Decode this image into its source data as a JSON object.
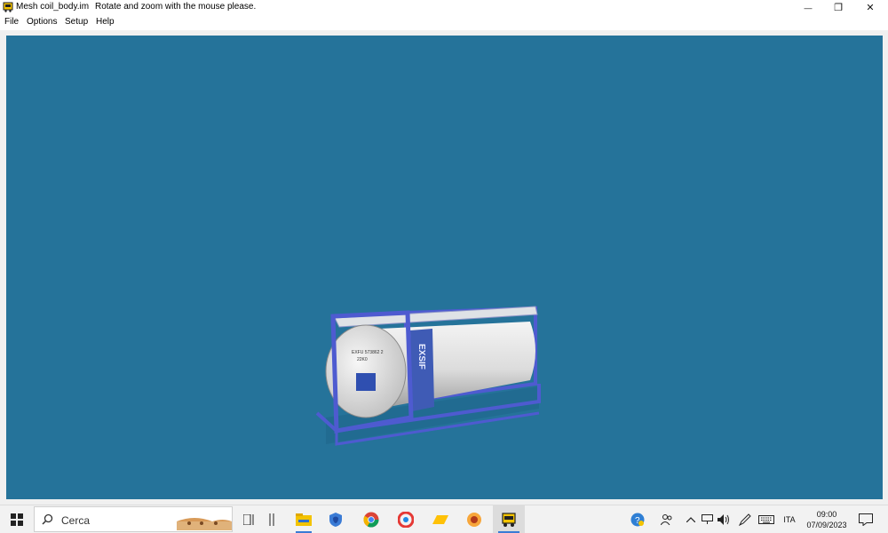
{
  "window": {
    "title": "Mesh coil_body.im",
    "hint": "Rotate and zoom with the mouse please.",
    "controls": {
      "minimize": "—",
      "restore": "❐",
      "close": "✕"
    }
  },
  "menu": {
    "items": [
      {
        "id": "file",
        "label": "File"
      },
      {
        "id": "options",
        "label": "Options"
      },
      {
        "id": "setup",
        "label": "Setup"
      },
      {
        "id": "help",
        "label": "Help"
      }
    ]
  },
  "viewport": {
    "background": "#25739a",
    "model": {
      "container_text": {
        "brand": "EXSIF",
        "code": "EXFU 573862 2",
        "type": "22K0"
      }
    }
  },
  "taskbar": {
    "search_placeholder": "Cerca",
    "apps": [
      "start-icon",
      "task-view-icon",
      "file-explorer-icon",
      "security-icon",
      "chrome-icon",
      "app-icon",
      "folder-icon",
      "game-icon",
      "mesh-viewer-icon"
    ],
    "tray": {
      "language": "ITA",
      "time": "09:00",
      "date": "07/09/2023"
    }
  },
  "colors": {
    "accent": "#3a7bd5",
    "frame_blue": "#4e5bd0"
  }
}
